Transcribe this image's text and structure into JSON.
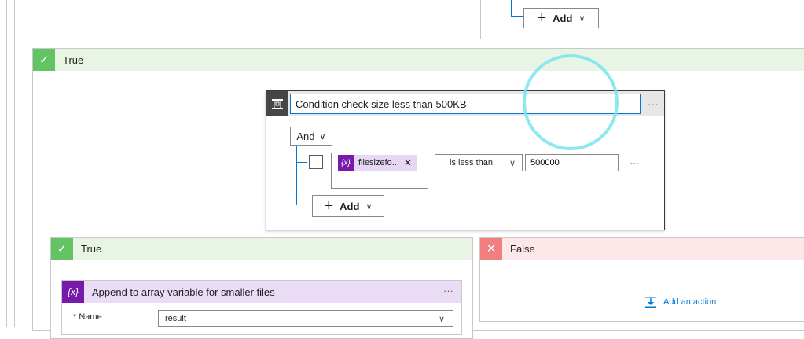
{
  "top_add": {
    "label": "Add"
  },
  "true_outer": {
    "label": "True"
  },
  "condition": {
    "title": "Condition check size less than 500KB",
    "more": "···",
    "group_operator": "And",
    "row": {
      "token_label": "filesizefo...",
      "token_icon": "{x}",
      "operator": "is less than",
      "value": "500000",
      "more": "···"
    },
    "add_label": "Add"
  },
  "true_inner": {
    "label": "True"
  },
  "false_inner": {
    "label": "False",
    "add_action": "Add an action"
  },
  "append": {
    "icon": "{x}",
    "title": "Append to array variable for smaller files",
    "more": "···",
    "name_label": "Name",
    "name_value": "result"
  },
  "colors": {
    "accent": "#0078d4",
    "true_green": "#62c462",
    "false_red": "#f08080",
    "variable_purple": "#7719aa",
    "highlight_cyan": "#7ae4ec"
  }
}
